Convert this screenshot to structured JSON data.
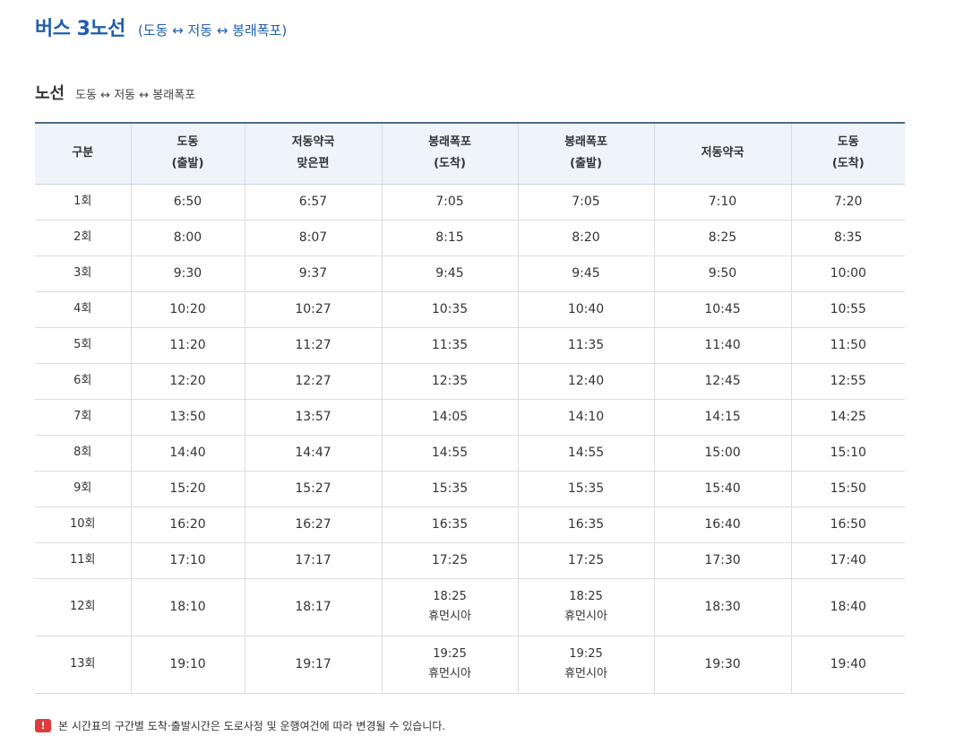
{
  "page": {
    "title": "버스 3노선",
    "title_sub": "(도동 ↔ 저동 ↔ 봉래폭포)"
  },
  "section": {
    "title": "노선",
    "subtitle": "도동 ↔ 저동 ↔ 봉래폭포"
  },
  "table": {
    "headers": [
      [
        "구분"
      ],
      [
        "도동",
        "(출발)"
      ],
      [
        "저동약국",
        "맞은편"
      ],
      [
        "봉래폭포",
        "(도착)"
      ],
      [
        "봉래폭포",
        "(출발)"
      ],
      [
        "저동약국"
      ],
      [
        "도동",
        "(도착)"
      ]
    ],
    "rows": [
      {
        "run": "1회",
        "c1": "6:50",
        "c2": "6:57",
        "c3": "7:05",
        "c4": "7:05",
        "c5": "7:10",
        "c6": "7:20"
      },
      {
        "run": "2회",
        "c1": "8:00",
        "c2": "8:07",
        "c3": "8:15",
        "c4": "8:20",
        "c5": "8:25",
        "c6": "8:35"
      },
      {
        "run": "3회",
        "c1": "9:30",
        "c2": "9:37",
        "c3": "9:45",
        "c4": "9:45",
        "c5": "9:50",
        "c6": "10:00"
      },
      {
        "run": "4회",
        "c1": "10:20",
        "c2": "10:27",
        "c3": "10:35",
        "c4": "10:40",
        "c5": "10:45",
        "c6": "10:55"
      },
      {
        "run": "5회",
        "c1": "11:20",
        "c2": "11:27",
        "c3": "11:35",
        "c4": "11:35",
        "c5": "11:40",
        "c6": "11:50"
      },
      {
        "run": "6회",
        "c1": "12:20",
        "c2": "12:27",
        "c3": "12:35",
        "c4": "12:40",
        "c5": "12:45",
        "c6": "12:55"
      },
      {
        "run": "7회",
        "c1": "13:50",
        "c2": "13:57",
        "c3": "14:05",
        "c4": "14:10",
        "c5": "14:15",
        "c6": "14:25"
      },
      {
        "run": "8회",
        "c1": "14:40",
        "c2": "14:47",
        "c3": "14:55",
        "c4": "14:55",
        "c5": "15:00",
        "c6": "15:10"
      },
      {
        "run": "9회",
        "c1": "15:20",
        "c2": "15:27",
        "c3": "15:35",
        "c4": "15:35",
        "c5": "15:40",
        "c6": "15:50"
      },
      {
        "run": "10회",
        "c1": "16:20",
        "c2": "16:27",
        "c3": "16:35",
        "c4": "16:35",
        "c5": "16:40",
        "c6": "16:50"
      },
      {
        "run": "11회",
        "c1": "17:10",
        "c2": "17:17",
        "c3": "17:25",
        "c4": "17:25",
        "c5": "17:30",
        "c6": "17:40"
      },
      {
        "run": "12회",
        "c1": "18:10",
        "c2": "18:17",
        "c3": "18:25",
        "c3_note": "휴먼시아",
        "c4": "18:25",
        "c4_note": "휴먼시아",
        "c5": "18:30",
        "c6": "18:40"
      },
      {
        "run": "13회",
        "c1": "19:10",
        "c2": "19:17",
        "c3": "19:25",
        "c3_note": "휴먼시아",
        "c4": "19:25",
        "c4_note": "휴먼시아",
        "c5": "19:30",
        "c6": "19:40"
      }
    ]
  },
  "notice": {
    "icon": "exclamation-icon",
    "icon_glyph": "!",
    "icon_color": "#e03a3a",
    "text": "본 시간표의 구간별 도착·출발시간은 도로사정 및 운행여건에 따라 변경될 수 있습니다."
  },
  "colors": {
    "title": "#1f5fad",
    "header_bg": "#eef4fa"
  }
}
